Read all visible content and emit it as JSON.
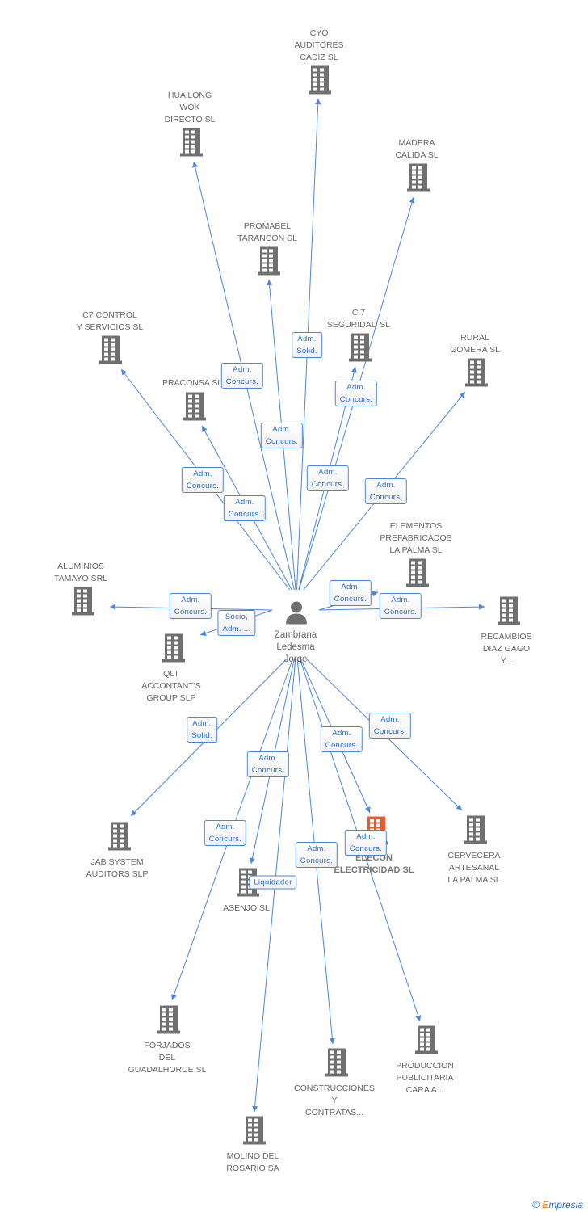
{
  "center": {
    "name_lines": [
      "Zambrana",
      "Ledesma",
      "Jorge"
    ],
    "icon": "person-icon"
  },
  "colors": {
    "edge": "#4a86e0",
    "building": "#707070",
    "highlight": "#f0572a",
    "text": "#666666"
  },
  "nodes": [
    {
      "lines": [
        "CYO",
        "AUDITORES",
        "CADIZ SL"
      ]
    },
    {
      "lines": [
        "HUA LONG",
        "WOK",
        "DIRECTO SL"
      ]
    },
    {
      "lines": [
        "MADERA",
        "CALIDA SL"
      ]
    },
    {
      "lines": [
        "PROMABEL",
        "TARANCON SL"
      ]
    },
    {
      "lines": [
        "C7 CONTROL",
        "Y SERVICIOS SL"
      ]
    },
    {
      "lines": [
        "C 7",
        "SEGURIDAD SL"
      ]
    },
    {
      "lines": [
        "RURAL",
        "GOMERA SL"
      ]
    },
    {
      "lines": [
        "PRACONSA SL"
      ]
    },
    {
      "lines": [
        "ELEMENTOS",
        "PREFABRICADOS",
        "LA PALMA SL"
      ]
    },
    {
      "lines": [
        "ALUMINIOS",
        "TAMAYO SRL"
      ]
    },
    {
      "lines": [
        "RECAMBIOS",
        "DIAZ GAGO",
        "Y..."
      ]
    },
    {
      "lines": [
        "QLT",
        "ACCONTANT'S",
        "GROUP SLP"
      ]
    },
    {
      "lines": [
        "JAB SYSTEM",
        "AUDITORS SLP"
      ]
    },
    {
      "lines": [
        "CERVECERA",
        "ARTESANAL",
        "LA PALMA SL"
      ]
    },
    {
      "lines": [
        "ELECON",
        "ELECTRICIDAD SL"
      ],
      "highlight": true
    },
    {
      "lines": [
        "ASENJO SL"
      ]
    },
    {
      "lines": [
        "FORJADOS",
        "DEL",
        "GUADALHORCE SL"
      ]
    },
    {
      "lines": [
        "PRODUCCION",
        "PUBLICITARIA",
        "CARA A..."
      ]
    },
    {
      "lines": [
        "CONSTRUCCIONES",
        "Y",
        "CONTRATAS..."
      ]
    },
    {
      "lines": [
        "MOLINO DEL",
        "ROSARIO SA"
      ]
    }
  ],
  "edges": [
    {
      "to": 0,
      "label": [
        "Adm.",
        "Solid."
      ]
    },
    {
      "to": 1,
      "label": [
        "Adm.",
        "Concurs."
      ]
    },
    {
      "to": 2,
      "label": [
        "Adm.",
        "Concurs."
      ]
    },
    {
      "to": 3,
      "label": [
        "Adm.",
        "Concurs."
      ]
    },
    {
      "to": 4,
      "label": [
        "Adm.",
        "Concurs."
      ]
    },
    {
      "to": 5,
      "label": [
        "Adm.",
        "Concurs."
      ]
    },
    {
      "to": 6,
      "label": [
        "Adm.",
        "Concurs."
      ]
    },
    {
      "to": 7,
      "label": [
        "Adm.",
        "Concurs."
      ]
    },
    {
      "to": 8,
      "label": [
        "Adm.",
        "Concurs."
      ]
    },
    {
      "to": 9,
      "label": [
        "Adm.",
        "Concurs."
      ]
    },
    {
      "to": 10,
      "label": [
        "Adm.",
        "Concurs."
      ]
    },
    {
      "to": 11,
      "label": [
        "Socio,",
        "Adm. ..."
      ]
    },
    {
      "to": 12,
      "label": [
        "Adm.",
        "Solid."
      ]
    },
    {
      "to": 13,
      "label": [
        "Adm.",
        "Concurs."
      ]
    },
    {
      "to": 14,
      "label": [
        "Adm.",
        "Concurs."
      ]
    },
    {
      "to": 15,
      "label": [
        "Adm.",
        "Concurs."
      ]
    },
    {
      "to": 16,
      "label": [
        "Adm.",
        "Concurs."
      ]
    },
    {
      "to": 17,
      "label": [
        "Adm.",
        "Concurs."
      ]
    },
    {
      "to": 18,
      "label": [
        "Adm.",
        "Concurs."
      ]
    },
    {
      "to": 19,
      "label": [
        "Liquidador"
      ]
    }
  ],
  "footer": {
    "copyright": "©",
    "brand_initial": "E",
    "brand_rest": "mpresia"
  }
}
